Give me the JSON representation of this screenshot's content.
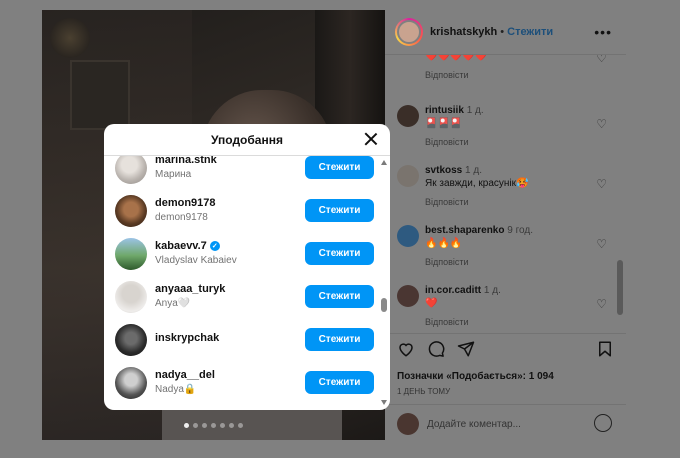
{
  "post": {
    "owner": "krishatskykh",
    "separator": "•",
    "follow_label": "Стежити",
    "more_label": "•••"
  },
  "comments": [
    {
      "user": "",
      "time": "",
      "text": "❤️❤️❤️❤️❤️",
      "reply": "Відповісти"
    },
    {
      "user": "rintusiik",
      "time": "1 д.",
      "text": "🎴🎴🎴",
      "reply": "Відповісти"
    },
    {
      "user": "svtkoss",
      "time": "1 д.",
      "text": "Як завжди, красунік🥵",
      "reply": "Відповісти"
    },
    {
      "user": "best.shaparenko",
      "time": "9 год.",
      "text": "🔥🔥🔥",
      "reply": "Відповісти"
    },
    {
      "user": "in.cor.caditt",
      "time": "1 д.",
      "text": "❤️",
      "reply": "Відповісти"
    }
  ],
  "actions": {
    "likes_text": "Позначки «Подобається»: 1 094",
    "posted": "1 ДЕНЬ ТОМУ",
    "comment_placeholder": "Додайте коментар..."
  },
  "modal": {
    "title": "Уподобання",
    "users": [
      {
        "username": "marina.stnk",
        "fullname": "Марина",
        "verified": false,
        "button": "Стежити"
      },
      {
        "username": "demon9178",
        "fullname": "demon9178",
        "verified": false,
        "button": "Стежити"
      },
      {
        "username": "kabaevv.7",
        "fullname": "Vladyslav Kabaiev",
        "verified": true,
        "button": "Стежити"
      },
      {
        "username": "anyaaa_turyk",
        "fullname": "Anya🤍",
        "verified": false,
        "button": "Стежити"
      },
      {
        "username": "inskrypchak",
        "fullname": "",
        "verified": false,
        "button": "Стежити"
      },
      {
        "username": "nadya__del",
        "fullname": "Nadya🔒",
        "verified": false,
        "button": "Стежити"
      }
    ]
  },
  "colors": {
    "accent": "#0095f6",
    "overlay": "#808080"
  }
}
